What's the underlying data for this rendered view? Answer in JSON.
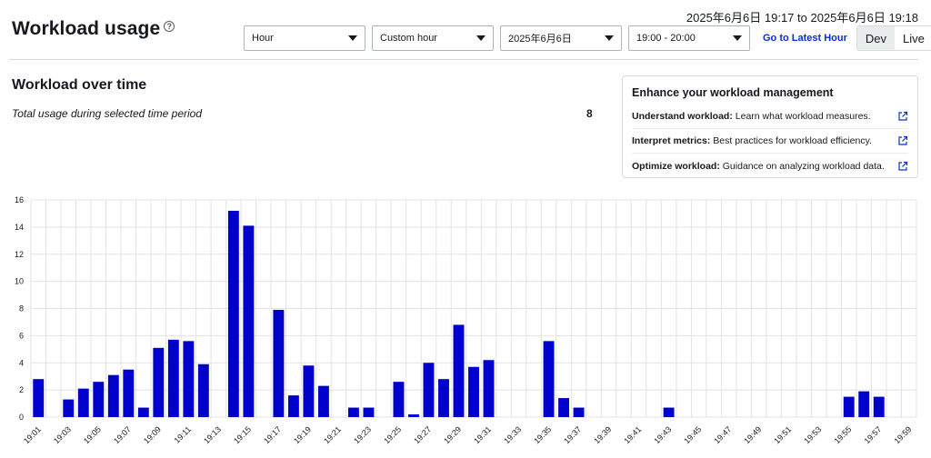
{
  "header": {
    "title": "Workload usage",
    "range_text": "2025年6月6日 19:17 to 2025年6月6日 19:18"
  },
  "controls": {
    "granularity": "Hour",
    "mode": "Custom hour",
    "date": "2025年6月6日",
    "time_range": "19:00 - 20:00",
    "latest_link": "Go to Latest Hour",
    "env_options": [
      "Dev",
      "Live"
    ],
    "env_selected": "Dev"
  },
  "section": {
    "title": "Workload over time",
    "total_label": "Total usage during selected time period",
    "total_value": "8"
  },
  "info_card": {
    "title": "Enhance your workload management",
    "items": [
      {
        "strong": "Understand workload:",
        "text": " Learn what workload measures."
      },
      {
        "strong": "Interpret metrics:",
        "text": " Best practices for workload efficiency."
      },
      {
        "strong": "Optimize workload:",
        "text": " Guidance on analyzing workload data."
      }
    ]
  },
  "colors": {
    "bar": "#0000cc",
    "grid": "#e3e3e3",
    "link": "#0a2ecc"
  },
  "chart_data": {
    "type": "bar",
    "title": "",
    "xlabel": "",
    "ylabel": "",
    "ylim": [
      0,
      16
    ],
    "yticks": [
      0,
      2,
      4,
      6,
      8,
      10,
      12,
      14,
      16
    ],
    "grid": true,
    "x_tick_labels": [
      "19:01",
      "19:03",
      "19:05",
      "19:07",
      "19:09",
      "19:11",
      "19:13",
      "19:15",
      "19:17",
      "19:19",
      "19:21",
      "19:23",
      "19:25",
      "19:27",
      "19:29",
      "19:31",
      "19:33",
      "19:35",
      "19:37",
      "19:39",
      "19:41",
      "19:43",
      "19:45",
      "19:47",
      "19:49",
      "19:51",
      "19:53",
      "19:55",
      "19:57",
      "19:59"
    ],
    "categories": [
      "19:01",
      "19:02",
      "19:03",
      "19:04",
      "19:05",
      "19:06",
      "19:07",
      "19:08",
      "19:09",
      "19:10",
      "19:11",
      "19:12",
      "19:13",
      "19:14",
      "19:15",
      "19:16",
      "19:17",
      "19:18",
      "19:19",
      "19:20",
      "19:21",
      "19:22",
      "19:23",
      "19:24",
      "19:25",
      "19:26",
      "19:27",
      "19:28",
      "19:29",
      "19:30",
      "19:31",
      "19:32",
      "19:33",
      "19:34",
      "19:35",
      "19:36",
      "19:37",
      "19:38",
      "19:39",
      "19:40",
      "19:41",
      "19:42",
      "19:43",
      "19:44",
      "19:45",
      "19:46",
      "19:47",
      "19:48",
      "19:49",
      "19:50",
      "19:51",
      "19:52",
      "19:53",
      "19:54",
      "19:55",
      "19:56",
      "19:57",
      "19:58",
      "19:59"
    ],
    "values": [
      2.8,
      0,
      1.3,
      2.1,
      2.6,
      3.1,
      3.5,
      0.7,
      5.1,
      5.7,
      5.6,
      3.9,
      0,
      15.2,
      14.1,
      0,
      7.9,
      1.6,
      3.8,
      2.3,
      0,
      0.7,
      0.7,
      0,
      2.6,
      0.2,
      4.0,
      2.8,
      6.8,
      3.7,
      4.2,
      0,
      0,
      0,
      5.6,
      1.4,
      0.7,
      0,
      0,
      0,
      0,
      0,
      0.7,
      0,
      0,
      0,
      0,
      0,
      0,
      0,
      0,
      0,
      0,
      0,
      1.5,
      1.9,
      1.5,
      0,
      0
    ]
  }
}
